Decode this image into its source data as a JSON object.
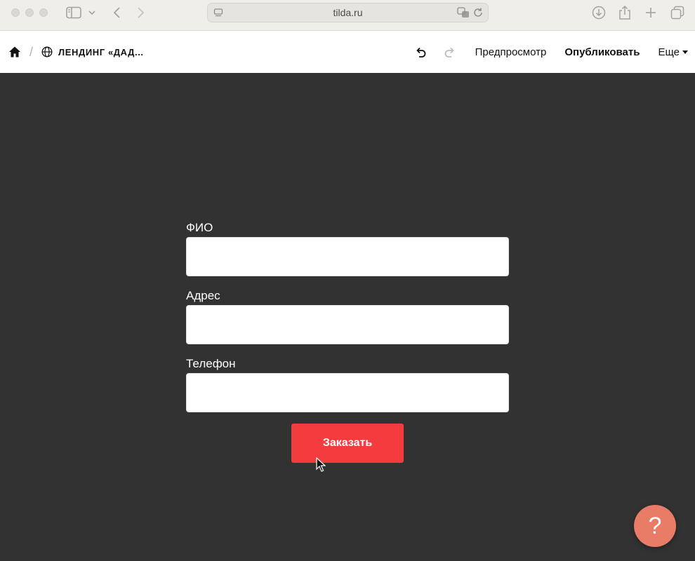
{
  "browser": {
    "url": "tilda.ru"
  },
  "toolbar": {
    "page_name": "ЛЕНДИНГ «ДАД...",
    "preview_label": "Предпросмотр",
    "publish_label": "Опубликовать",
    "more_label": "Еще"
  },
  "form": {
    "fields": [
      {
        "label": "ФИО"
      },
      {
        "label": "Адрес"
      },
      {
        "label": "Телефон"
      }
    ],
    "submit_label": "Заказать"
  },
  "help": {
    "label": "?"
  },
  "colors": {
    "page_background": "#323232",
    "submit_button": "#f43c3e",
    "help_button": "#e97c66"
  },
  "icons": [
    "sidebar-icon",
    "chevron-down-icon",
    "back-icon",
    "forward-icon",
    "tab-icon",
    "translate-icon",
    "reload-icon",
    "download-icon",
    "share-icon",
    "new-tab-icon",
    "tabs-overview-icon",
    "home-icon",
    "globe-icon",
    "undo-icon",
    "redo-icon",
    "cursor-icon"
  ]
}
